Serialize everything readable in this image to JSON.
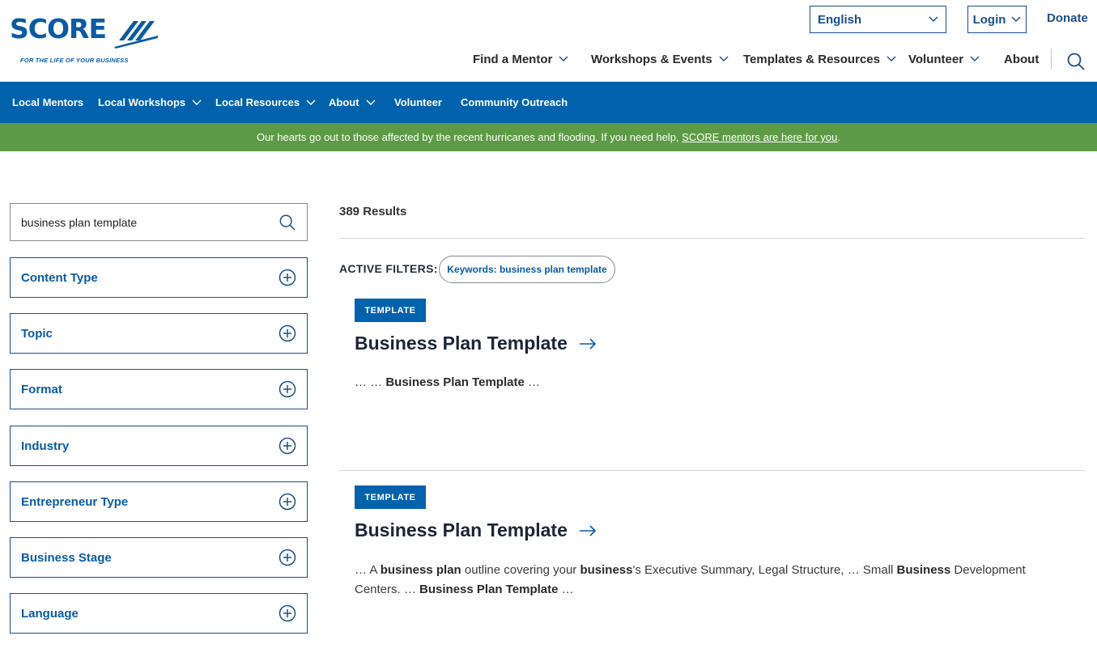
{
  "brand": {
    "name": "SCORE",
    "tagline": "FOR THE LIFE OF YOUR BUSINESS",
    "color": "#0a5aa6"
  },
  "utility": {
    "language_selected": "English",
    "login_label": "Login",
    "donate_label": "Donate"
  },
  "main_nav": {
    "items": [
      {
        "label": "Find a Mentor",
        "has_dropdown": true
      },
      {
        "label": "Workshops & Events",
        "has_dropdown": true
      },
      {
        "label": "Templates & Resources",
        "has_dropdown": true
      },
      {
        "label": "Volunteer",
        "has_dropdown": true
      },
      {
        "label": "About",
        "has_dropdown": false
      }
    ],
    "search_icon": "search-icon"
  },
  "local_nav": {
    "background": "#0062ad",
    "items": [
      {
        "label": "Local Mentors",
        "has_dropdown": false
      },
      {
        "label": "Local Workshops",
        "has_dropdown": true
      },
      {
        "label": "Local Resources",
        "has_dropdown": true
      },
      {
        "label": "About",
        "has_dropdown": true
      },
      {
        "label": "Volunteer",
        "has_dropdown": false
      },
      {
        "label": "Community Outreach",
        "has_dropdown": false
      }
    ]
  },
  "alert": {
    "background": "#5d9a45",
    "text": "Our hearts go out to those affected by the recent hurricanes and flooding. If you need help,",
    "link_text": "SCORE mentors are here for you",
    "suffix": "."
  },
  "sidebar": {
    "search_value": "business plan template",
    "filters": [
      "Content Type",
      "Topic",
      "Format",
      "Industry",
      "Entrepreneur Type",
      "Business Stage",
      "Language"
    ]
  },
  "results": {
    "count_label": "389 Results",
    "active_filters_label": "ACTIVE FILTERS:",
    "active_filter_chip": "Keywords: business plan template",
    "items": [
      {
        "tag": "TEMPLATE",
        "title": "Business Plan Template",
        "snippet": [
          {
            "text": "… … ",
            "bold": false
          },
          {
            "text": "Business Plan Template",
            "bold": true
          },
          {
            "text": " …",
            "bold": false
          }
        ]
      },
      {
        "tag": "TEMPLATE",
        "title": "Business Plan Template",
        "snippet": [
          {
            "text": "… A ",
            "bold": false
          },
          {
            "text": "business plan",
            "bold": true
          },
          {
            "text": " outline covering your ",
            "bold": false
          },
          {
            "text": "business",
            "bold": true
          },
          {
            "text": "'s Executive Summary, Legal Structure, … Small ",
            "bold": false
          },
          {
            "text": "Business",
            "bold": true
          },
          {
            "text": " Development Centers. … ",
            "bold": false
          },
          {
            "text": "Business Plan Template",
            "bold": true
          },
          {
            "text": " …",
            "bold": false
          }
        ]
      }
    ]
  }
}
